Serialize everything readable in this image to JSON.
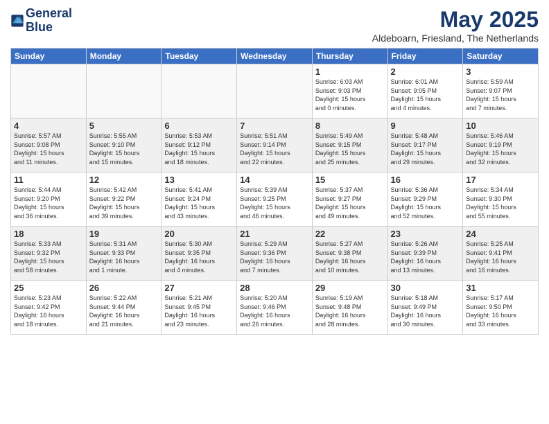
{
  "header": {
    "logo_line1": "General",
    "logo_line2": "Blue",
    "month_year": "May 2025",
    "location": "Aldeboarn, Friesland, The Netherlands"
  },
  "days_of_week": [
    "Sunday",
    "Monday",
    "Tuesday",
    "Wednesday",
    "Thursday",
    "Friday",
    "Saturday"
  ],
  "weeks": [
    [
      {
        "day": "",
        "info": "",
        "empty": true
      },
      {
        "day": "",
        "info": "",
        "empty": true
      },
      {
        "day": "",
        "info": "",
        "empty": true
      },
      {
        "day": "",
        "info": "",
        "empty": true
      },
      {
        "day": "1",
        "info": "Sunrise: 6:03 AM\nSunset: 9:03 PM\nDaylight: 15 hours\nand 0 minutes."
      },
      {
        "day": "2",
        "info": "Sunrise: 6:01 AM\nSunset: 9:05 PM\nDaylight: 15 hours\nand 4 minutes."
      },
      {
        "day": "3",
        "info": "Sunrise: 5:59 AM\nSunset: 9:07 PM\nDaylight: 15 hours\nand 7 minutes."
      }
    ],
    [
      {
        "day": "4",
        "info": "Sunrise: 5:57 AM\nSunset: 9:08 PM\nDaylight: 15 hours\nand 11 minutes."
      },
      {
        "day": "5",
        "info": "Sunrise: 5:55 AM\nSunset: 9:10 PM\nDaylight: 15 hours\nand 15 minutes."
      },
      {
        "day": "6",
        "info": "Sunrise: 5:53 AM\nSunset: 9:12 PM\nDaylight: 15 hours\nand 18 minutes."
      },
      {
        "day": "7",
        "info": "Sunrise: 5:51 AM\nSunset: 9:14 PM\nDaylight: 15 hours\nand 22 minutes."
      },
      {
        "day": "8",
        "info": "Sunrise: 5:49 AM\nSunset: 9:15 PM\nDaylight: 15 hours\nand 25 minutes."
      },
      {
        "day": "9",
        "info": "Sunrise: 5:48 AM\nSunset: 9:17 PM\nDaylight: 15 hours\nand 29 minutes."
      },
      {
        "day": "10",
        "info": "Sunrise: 5:46 AM\nSunset: 9:19 PM\nDaylight: 15 hours\nand 32 minutes."
      }
    ],
    [
      {
        "day": "11",
        "info": "Sunrise: 5:44 AM\nSunset: 9:20 PM\nDaylight: 15 hours\nand 36 minutes."
      },
      {
        "day": "12",
        "info": "Sunrise: 5:42 AM\nSunset: 9:22 PM\nDaylight: 15 hours\nand 39 minutes."
      },
      {
        "day": "13",
        "info": "Sunrise: 5:41 AM\nSunset: 9:24 PM\nDaylight: 15 hours\nand 43 minutes."
      },
      {
        "day": "14",
        "info": "Sunrise: 5:39 AM\nSunset: 9:25 PM\nDaylight: 15 hours\nand 46 minutes."
      },
      {
        "day": "15",
        "info": "Sunrise: 5:37 AM\nSunset: 9:27 PM\nDaylight: 15 hours\nand 49 minutes."
      },
      {
        "day": "16",
        "info": "Sunrise: 5:36 AM\nSunset: 9:29 PM\nDaylight: 15 hours\nand 52 minutes."
      },
      {
        "day": "17",
        "info": "Sunrise: 5:34 AM\nSunset: 9:30 PM\nDaylight: 15 hours\nand 55 minutes."
      }
    ],
    [
      {
        "day": "18",
        "info": "Sunrise: 5:33 AM\nSunset: 9:32 PM\nDaylight: 15 hours\nand 58 minutes."
      },
      {
        "day": "19",
        "info": "Sunrise: 5:31 AM\nSunset: 9:33 PM\nDaylight: 16 hours\nand 1 minute."
      },
      {
        "day": "20",
        "info": "Sunrise: 5:30 AM\nSunset: 9:35 PM\nDaylight: 16 hours\nand 4 minutes."
      },
      {
        "day": "21",
        "info": "Sunrise: 5:29 AM\nSunset: 9:36 PM\nDaylight: 16 hours\nand 7 minutes."
      },
      {
        "day": "22",
        "info": "Sunrise: 5:27 AM\nSunset: 9:38 PM\nDaylight: 16 hours\nand 10 minutes."
      },
      {
        "day": "23",
        "info": "Sunrise: 5:26 AM\nSunset: 9:39 PM\nDaylight: 16 hours\nand 13 minutes."
      },
      {
        "day": "24",
        "info": "Sunrise: 5:25 AM\nSunset: 9:41 PM\nDaylight: 16 hours\nand 16 minutes."
      }
    ],
    [
      {
        "day": "25",
        "info": "Sunrise: 5:23 AM\nSunset: 9:42 PM\nDaylight: 16 hours\nand 18 minutes."
      },
      {
        "day": "26",
        "info": "Sunrise: 5:22 AM\nSunset: 9:44 PM\nDaylight: 16 hours\nand 21 minutes."
      },
      {
        "day": "27",
        "info": "Sunrise: 5:21 AM\nSunset: 9:45 PM\nDaylight: 16 hours\nand 23 minutes."
      },
      {
        "day": "28",
        "info": "Sunrise: 5:20 AM\nSunset: 9:46 PM\nDaylight: 16 hours\nand 26 minutes."
      },
      {
        "day": "29",
        "info": "Sunrise: 5:19 AM\nSunset: 9:48 PM\nDaylight: 16 hours\nand 28 minutes."
      },
      {
        "day": "30",
        "info": "Sunrise: 5:18 AM\nSunset: 9:49 PM\nDaylight: 16 hours\nand 30 minutes."
      },
      {
        "day": "31",
        "info": "Sunrise: 5:17 AM\nSunset: 9:50 PM\nDaylight: 16 hours\nand 33 minutes."
      }
    ]
  ]
}
